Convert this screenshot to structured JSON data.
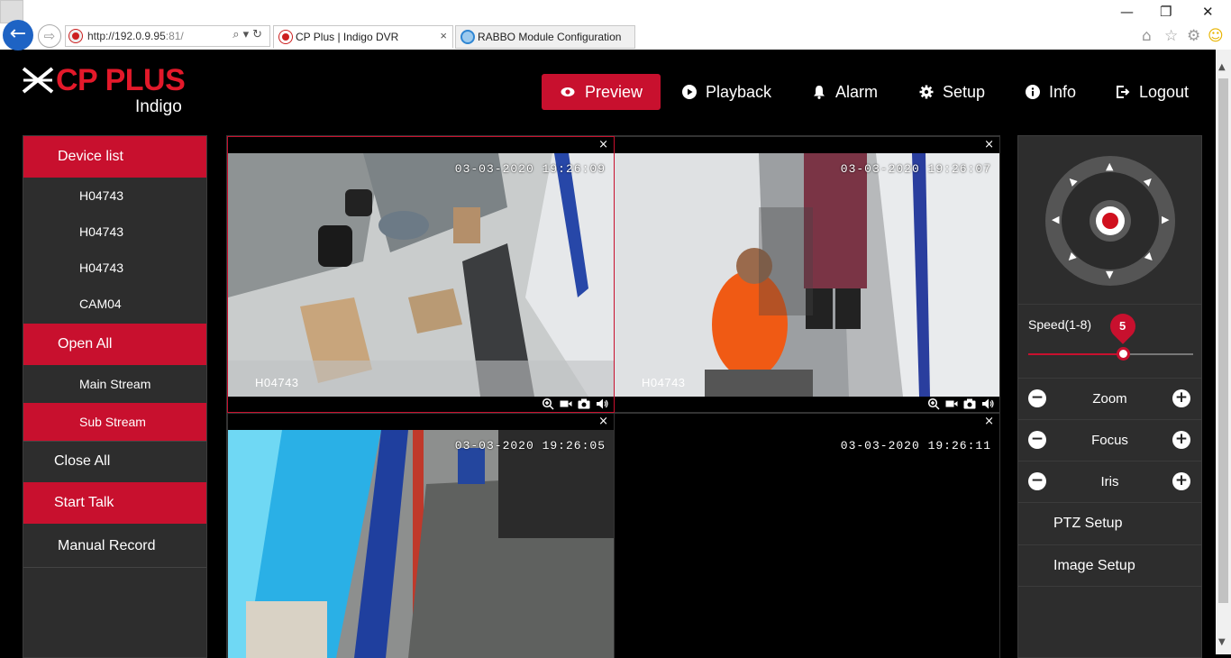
{
  "browser": {
    "url_main": "http://192.0.9.95",
    "url_port": ":81/",
    "tabs": [
      {
        "label": "CP Plus | Indigo DVR",
        "close": "×"
      },
      {
        "label": "RABBO Module Configuration"
      }
    ],
    "win_min": "—",
    "win_restore": "❐",
    "win_close": "✕",
    "addr_tools": "⌕▾↻",
    "back_glyph": "←",
    "fwd_glyph": "⇨",
    "home_icon": "⌂",
    "star_icon": "☆",
    "gear_icon": "⚙",
    "smiley_icon": "☺"
  },
  "app": {
    "logo_text": "CP PLUS",
    "logo_sub": "Indigo",
    "brand_color": "#c8102e",
    "nav": {
      "preview": "Preview",
      "playback": "Playback",
      "alarm": "Alarm",
      "setup": "Setup",
      "info": "Info",
      "logout": "Logout"
    }
  },
  "left_panel": {
    "device_list": "Device list",
    "devices": [
      "H04743",
      "H04743",
      "H04743",
      "CAM04"
    ],
    "open_all": "Open All",
    "main_stream": "Main Stream",
    "sub_stream": "Sub Stream",
    "close_all": "Close All",
    "start_talk": "Start Talk",
    "manual_record": "Manual Record"
  },
  "cameras": [
    {
      "timestamp": "03-03-2020 19:26:09",
      "name": "H04743",
      "close": "×"
    },
    {
      "timestamp": "03-03-2020 19:26:07",
      "name": "H04743",
      "close": "×"
    },
    {
      "timestamp": "03-03-2020 19:26:05",
      "name": "",
      "close": "×"
    },
    {
      "timestamp": "03-03-2020 19:26:11",
      "name": "",
      "close": "×"
    }
  ],
  "right_panel": {
    "speed_label": "Speed(1-8)",
    "speed_value": "5",
    "speed_level": 5,
    "speed_min": 1,
    "speed_max": 8,
    "zoom": "Zoom",
    "focus": "Focus",
    "iris": "Iris",
    "minus": "−",
    "plus": "+",
    "ptz_setup": "PTZ Setup",
    "image_setup": "Image Setup"
  }
}
